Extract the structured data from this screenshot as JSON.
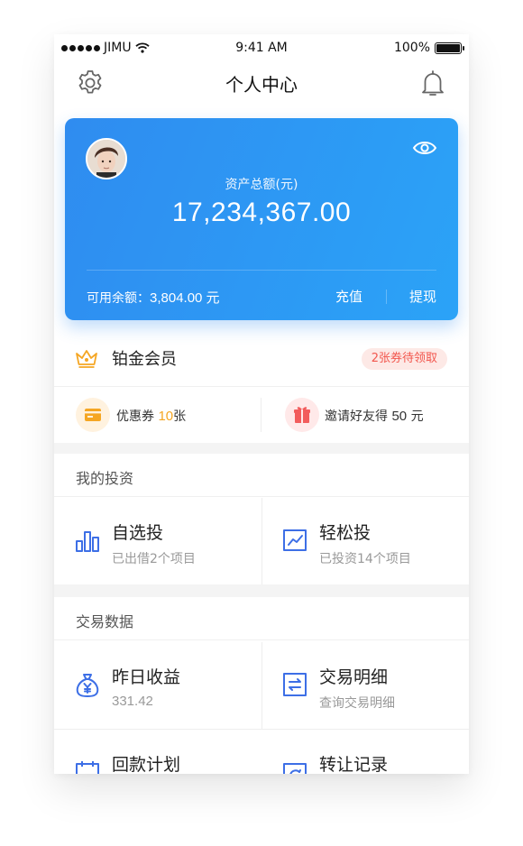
{
  "status_bar": {
    "carrier": "JIMU",
    "time": "9:41 AM",
    "battery": "100%"
  },
  "nav": {
    "title": "个人中心",
    "left_icon": "gear-icon",
    "right_icon": "bell-icon"
  },
  "asset_card": {
    "label": "资产总额(元)",
    "amount": "17,234,367.00",
    "available_label": "可用余额：",
    "available_value": "3,804.00 元",
    "recharge": "充值",
    "withdraw": "提现",
    "colors": {
      "gradient_start": "#2f8cf0",
      "gradient_end": "#2ba3f7"
    }
  },
  "membership": {
    "tier": "铂金会员",
    "badge": "2张券待领取",
    "badge_color": "#f2564d",
    "crown_color": "#f5a623"
  },
  "perks": {
    "coupon_label": "优惠券",
    "coupon_count": "10",
    "coupon_unit": "张",
    "invite_label": "邀请好友得",
    "invite_amount": "50",
    "invite_unit": "元"
  },
  "investments": {
    "title": "我的投资",
    "items": [
      {
        "title": "自选投",
        "subtitle": "已出借2个项目",
        "icon": "bar-chart-icon"
      },
      {
        "title": "轻松投",
        "subtitle": "已投资14个项目",
        "icon": "line-chart-icon"
      }
    ]
  },
  "transactions": {
    "title": "交易数据",
    "items": [
      {
        "title": "昨日收益",
        "subtitle": "331.42",
        "icon": "money-bag-icon"
      },
      {
        "title": "交易明细",
        "subtitle": "查询交易明细",
        "icon": "exchange-icon"
      },
      {
        "title": "回款计划",
        "subtitle": "",
        "icon": "calendar-icon"
      },
      {
        "title": "转让记录",
        "subtitle": "",
        "icon": "transfer-icon"
      }
    ]
  },
  "accent_color": "#3d6fe6"
}
